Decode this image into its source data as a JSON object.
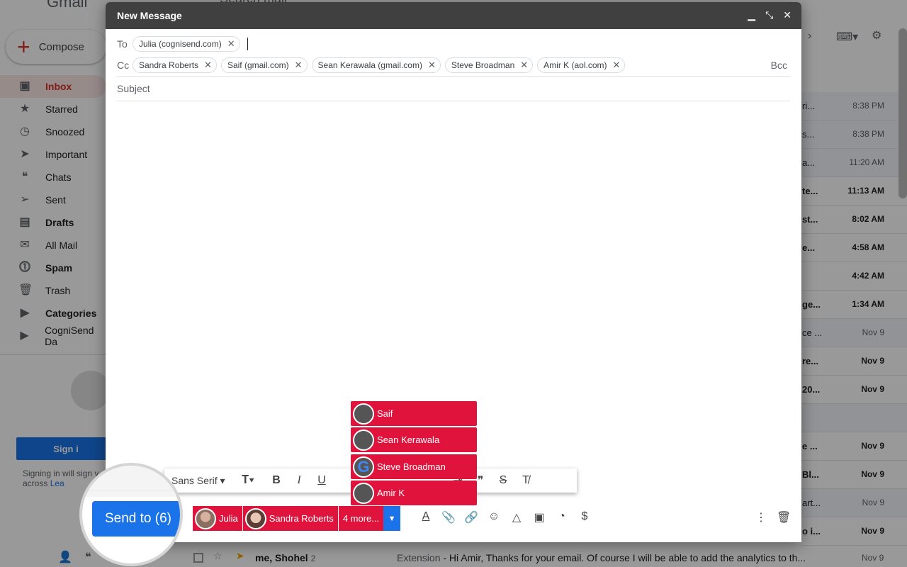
{
  "gmail": {
    "logo_text": "Gmail",
    "search_text": "Search mail",
    "compose_label": "Compose",
    "nav": [
      {
        "label": "Inbox",
        "icon": "inbox-icon",
        "glyph": "▣",
        "style": "active"
      },
      {
        "label": "Starred",
        "icon": "star-icon",
        "glyph": "★",
        "style": ""
      },
      {
        "label": "Snoozed",
        "icon": "clock-icon",
        "glyph": "◷",
        "style": ""
      },
      {
        "label": "Important",
        "icon": "important-icon",
        "glyph": "➤",
        "style": ""
      },
      {
        "label": "Chats",
        "icon": "chat-icon",
        "glyph": "❝",
        "style": ""
      },
      {
        "label": "Sent",
        "icon": "send-icon",
        "glyph": "➢",
        "style": ""
      },
      {
        "label": "Drafts",
        "icon": "draft-icon",
        "glyph": "▤",
        "style": "bold"
      },
      {
        "label": "All Mail",
        "icon": "mail-icon",
        "glyph": "✉",
        "style": ""
      },
      {
        "label": "Spam",
        "icon": "spam-icon",
        "glyph": "⓵",
        "style": "bold"
      },
      {
        "label": "Trash",
        "icon": "trash-icon",
        "glyph": "🗑",
        "style": ""
      },
      {
        "label": "Categories",
        "icon": "label-icon",
        "glyph": "▶",
        "style": "bold"
      },
      {
        "label": "CogniSend Da",
        "icon": "label-icon",
        "glyph": "▶",
        "style": ""
      }
    ],
    "signin_label": "Sign i",
    "signin_note": "Signing in will sign y across",
    "learn_label": "Lea",
    "list_rows": [
      {
        "snip": "ri...",
        "time": "8:38 PM",
        "unread": false
      },
      {
        "snip": "s...",
        "time": "8:38 PM",
        "unread": false
      },
      {
        "snip": "a...",
        "time": "11:20 AM",
        "unread": false
      },
      {
        "snip": "te...",
        "time": "11:13 AM",
        "unread": true
      },
      {
        "snip": "st...",
        "time": "8:02 AM",
        "unread": true
      },
      {
        "snip": "e...",
        "time": "4:58 AM",
        "unread": true
      },
      {
        "snip": "",
        "time": "4:42 AM",
        "unread": true
      },
      {
        "snip": "ge...",
        "time": "1:34 AM",
        "unread": true
      },
      {
        "snip": "ce ...",
        "time": "Nov 9",
        "unread": false
      },
      {
        "snip": "re...",
        "time": "Nov 9",
        "unread": true
      },
      {
        "snip": "20...",
        "time": "Nov 9",
        "unread": true
      },
      {
        "snip": "",
        "time": "",
        "unread": false
      },
      {
        "snip": "e ...",
        "time": "Nov 9",
        "unread": true
      },
      {
        "snip": "Bl...",
        "time": "Nov 9",
        "unread": true
      },
      {
        "snip": "art...",
        "time": "Nov 9",
        "unread": false
      },
      {
        "snip": "o i...",
        "time": "Nov 9",
        "unread": true
      }
    ],
    "last_row": {
      "from": "me, Shohel",
      "count": "2",
      "subject_prefix": "Extension",
      "subject": " - Hi Amir, Thanks for your email. Of course I will be able to add the analytics to th...",
      "time": "Nov 9"
    }
  },
  "compose": {
    "title": "New Message",
    "to_label": "To",
    "to_chips": [
      "Julia (cognisend.com)"
    ],
    "cc_label": "Cc",
    "cc_chips": [
      "Sandra Roberts",
      "Saif (gmail.com)",
      "Sean Kerawala (gmail.com)",
      "Steve Broadman",
      "Amir K (aol.com)"
    ],
    "bcc_label": "Bcc",
    "subject_placeholder": "Subject",
    "font_family": "Sans Serif",
    "send_label": "Send to (6)",
    "recipients_bar": [
      {
        "name": "Julia",
        "avatar": "av-julia"
      },
      {
        "name": "Sandra Roberts",
        "avatar": "av-sandra"
      }
    ],
    "more_label": "4 more...",
    "popup_recipients": [
      {
        "name": "Saif",
        "avatar": "av-saif"
      },
      {
        "name": "Sean Kerawala",
        "avatar": "av-sean"
      },
      {
        "name": "Steve Broadman",
        "avatar": "av-steve"
      },
      {
        "name": "Amir K",
        "avatar": "av-amir"
      }
    ]
  },
  "colors": {
    "accent_red": "#e0133c",
    "send_blue": "#1a73e8",
    "header_dark": "#404040"
  }
}
